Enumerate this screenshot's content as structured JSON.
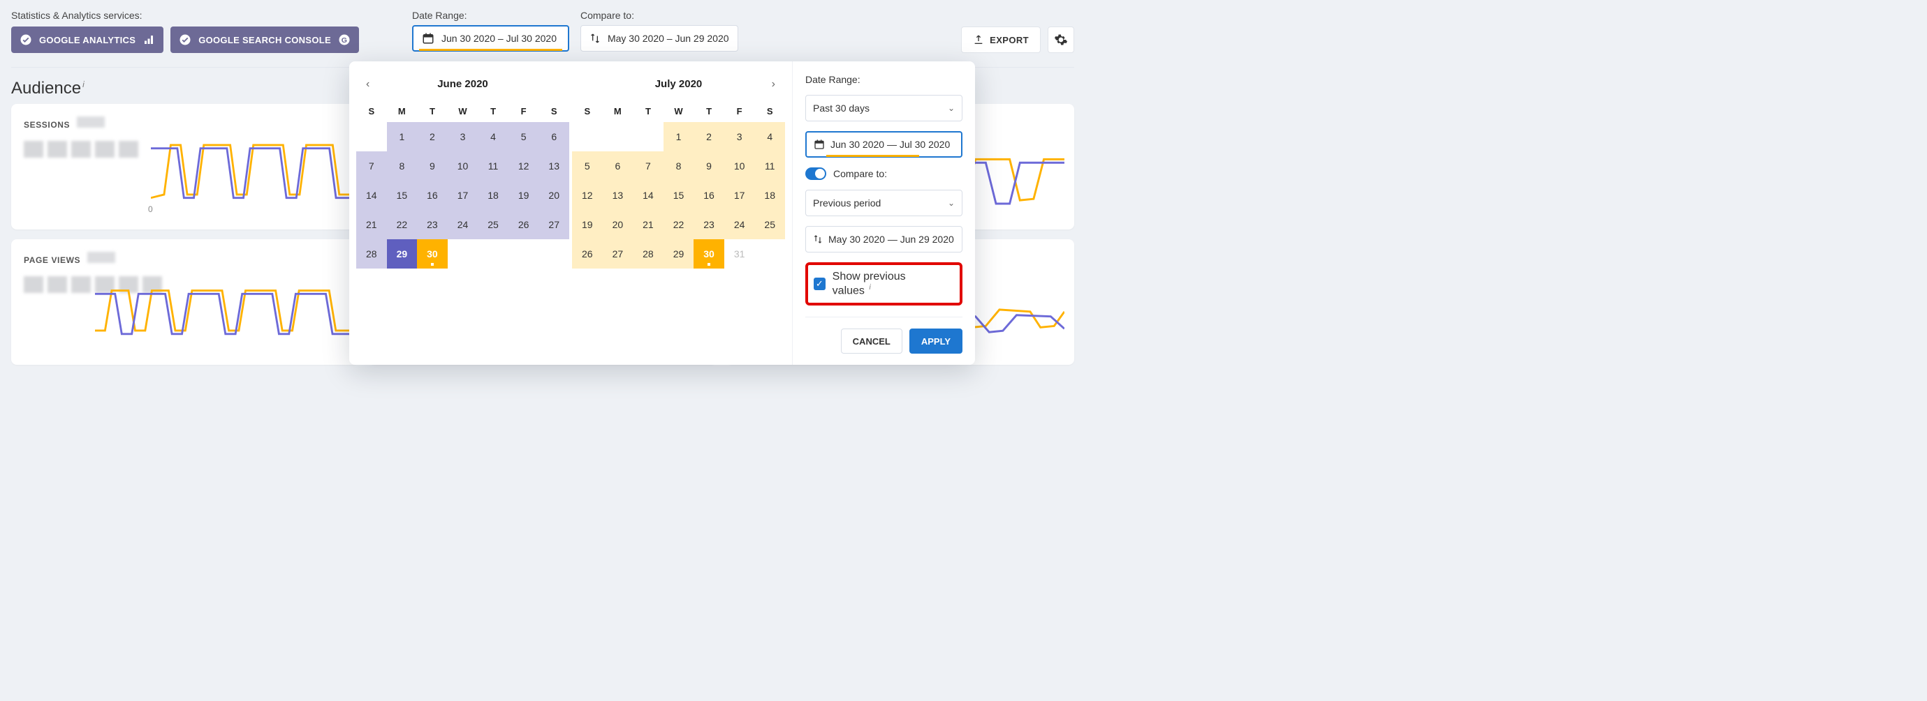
{
  "topbar": {
    "services_label": "Statistics & Analytics services:",
    "chip_ga": "GOOGLE ANALYTICS",
    "chip_gsc": "GOOGLE SEARCH CONSOLE",
    "date_range_label": "Date Range:",
    "date_range_value": "Jun 30 2020 – Jul 30 2020",
    "compare_label": "Compare to:",
    "compare_value": "May 30 2020 – Jun 29 2020",
    "export_label": "EXPORT"
  },
  "page": {
    "title": "Audience",
    "cards": {
      "sessions": "SESSIONS",
      "page_views": "PAGE VIEWS",
      "yaxis_zero": "0"
    }
  },
  "popover": {
    "month1": "June 2020",
    "month2": "July 2020",
    "dow": [
      "S",
      "M",
      "T",
      "W",
      "T",
      "F",
      "S"
    ],
    "june_grid": [
      "",
      "1",
      "2",
      "3",
      "4",
      "5",
      "6",
      "7",
      "8",
      "9",
      "10",
      "11",
      "12",
      "13",
      "14",
      "15",
      "16",
      "17",
      "18",
      "19",
      "20",
      "21",
      "22",
      "23",
      "24",
      "25",
      "26",
      "27",
      "28",
      "29",
      "30",
      "",
      "",
      "",
      ""
    ],
    "july_grid": [
      "",
      "",
      "",
      "1",
      "2",
      "3",
      "4",
      "5",
      "6",
      "7",
      "8",
      "9",
      "10",
      "11",
      "12",
      "13",
      "14",
      "15",
      "16",
      "17",
      "18",
      "19",
      "20",
      "21",
      "22",
      "23",
      "24",
      "25",
      "26",
      "27",
      "28",
      "29",
      "30",
      "31",
      ""
    ],
    "ctrl": {
      "range_label": "Date Range:",
      "preset": "Past 30 days",
      "range_value": "Jun 30 2020 — Jul 30 2020",
      "compare_label": "Compare to:",
      "compare_preset": "Previous period",
      "compare_value": "May 30 2020 — Jun 29 2020",
      "show_prev": "Show previous values",
      "cancel": "CANCEL",
      "apply": "APPLY"
    }
  },
  "colors": {
    "accent_blue": "#1e77d0",
    "accent_orange": "#ffb200",
    "range_june": "#cfcde8",
    "range_july": "#ffeec3",
    "chip": "#6d6a96"
  }
}
